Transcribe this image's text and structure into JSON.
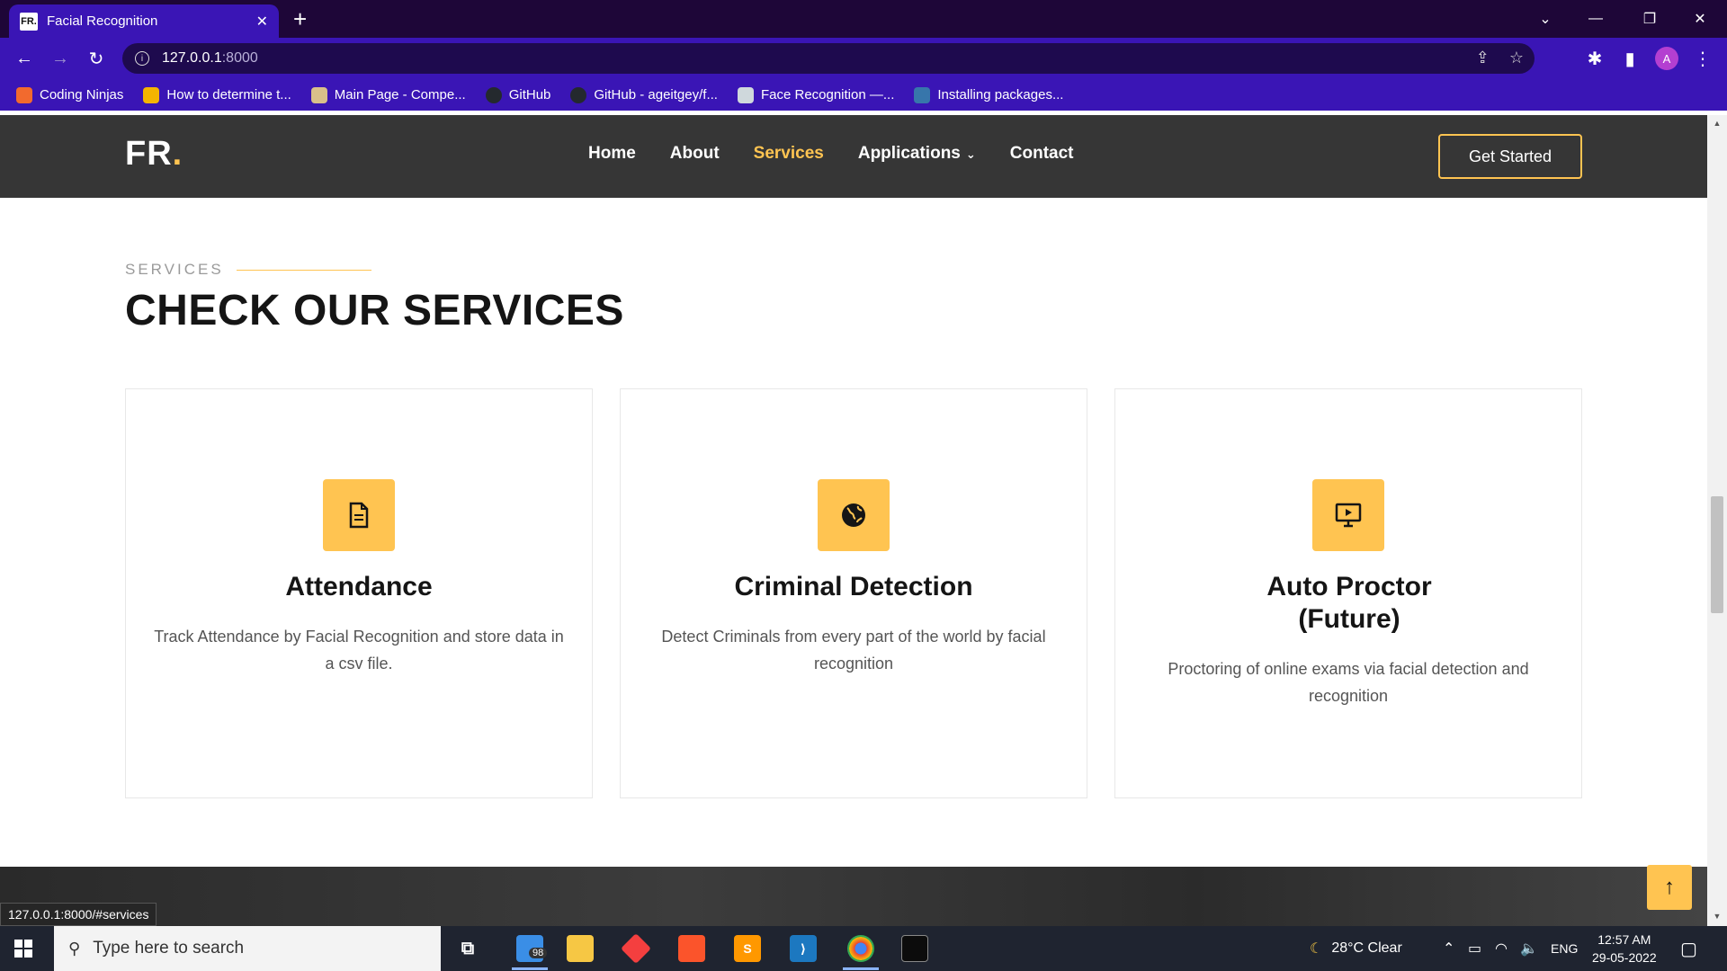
{
  "browser": {
    "tab_title": "Facial Recognition",
    "tab_favicon_text": "FR.",
    "url_host": "127.0.0.1",
    "url_port": ":8000",
    "profile_initial": "A",
    "bookmarks": [
      {
        "label": "Coding Ninjas",
        "color": "#f26a2e"
      },
      {
        "label": "How to determine t...",
        "color": "#f4b400"
      },
      {
        "label": "Main Page - Compe...",
        "color": "#d9c08a"
      },
      {
        "label": "GitHub",
        "color": "#24292e"
      },
      {
        "label": "GitHub - ageitgey/f...",
        "color": "#24292e"
      },
      {
        "label": "Face Recognition —...",
        "color": "#cfd8dc"
      },
      {
        "label": "Installing packages...",
        "color": "#3776ab"
      }
    ]
  },
  "site": {
    "logo_text": "FR",
    "logo_dot": ".",
    "nav": [
      {
        "label": "Home",
        "active": false
      },
      {
        "label": "About",
        "active": false
      },
      {
        "label": "Services",
        "active": true
      },
      {
        "label": "Applications",
        "active": false,
        "has_dropdown": true
      },
      {
        "label": "Contact",
        "active": false
      }
    ],
    "cta_label": "Get Started",
    "accent_color": "#ffc451",
    "section": {
      "eyebrow": "SERVICES",
      "title": "CHECK OUR SERVICES"
    },
    "services": [
      {
        "title": "Attendance",
        "desc": "Track Attendance by Facial Recognition and store data in a csv file.",
        "icon": "document-icon"
      },
      {
        "title": "Criminal Detection",
        "desc": "Detect Criminals from every part of the world by facial recognition",
        "icon": "globe-icon"
      },
      {
        "title": "Auto Proctor (Future)",
        "desc": "Proctoring of online exams via facial detection and recognition",
        "icon": "monitor-play-icon"
      }
    ],
    "status_bar_url": "127.0.0.1:8000/#services"
  },
  "taskbar": {
    "search_placeholder": "Type here to search",
    "badge_count": "98",
    "weather": "28°C  Clear",
    "language": "ENG",
    "time": "12:57 AM",
    "date": "29-05-2022"
  }
}
